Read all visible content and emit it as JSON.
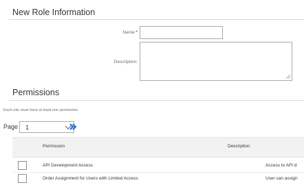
{
  "role_info": {
    "title": "New Role Information",
    "name_label": "Name:",
    "name_required_marker": "*",
    "name_value": "",
    "description_label": "Description:",
    "description_value": ""
  },
  "permissions": {
    "title": "Permissions",
    "hint": "Each role must have at least one permission.",
    "pagination": {
      "label": "Page",
      "current_page": "1"
    },
    "table": {
      "columns": [
        "Permission",
        "Description"
      ],
      "rows": [
        {
          "permission": "API Development Access",
          "description": "Access to API d",
          "checked": false
        },
        {
          "permission": "Order Assignment for Users with Limited Access",
          "description": "User can assign",
          "checked": false
        }
      ]
    }
  },
  "colors": {
    "link_accent": "#0a6ed1",
    "required": "#bb0000"
  },
  "icons": {
    "page_dropdown": "chevron-down-icon",
    "next_page": "double-chevron-right-icon",
    "textarea_resize": "resize-grip-icon"
  }
}
